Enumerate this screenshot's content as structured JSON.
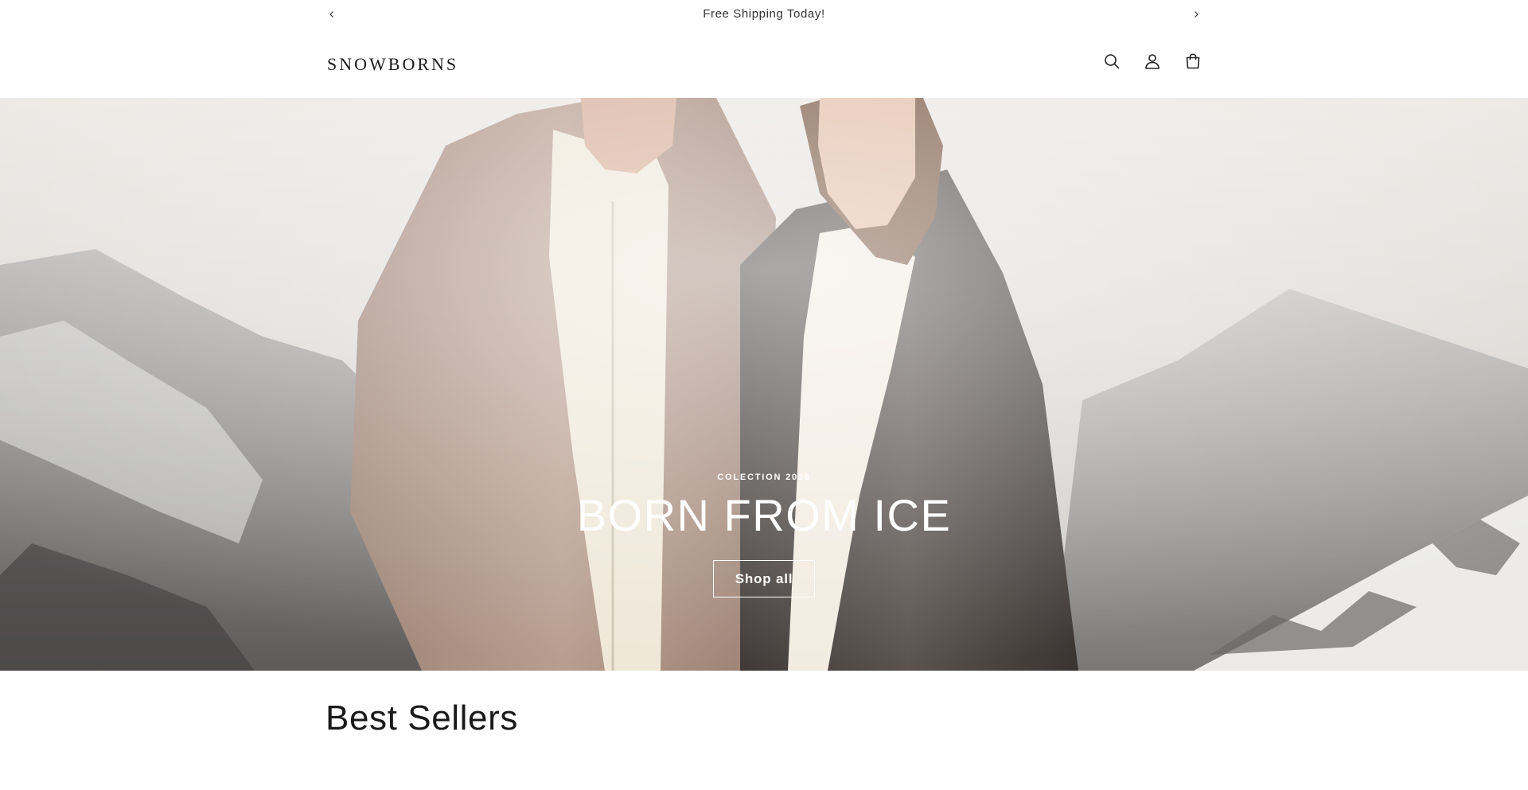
{
  "announcement": {
    "text": "Free Shipping Today!",
    "prev_icon": "chevron-left-icon",
    "next_icon": "chevron-right-icon"
  },
  "header": {
    "logo": "SNOWBORNS",
    "icons": [
      "search-icon",
      "account-icon",
      "cart-icon"
    ]
  },
  "hero": {
    "eyebrow": "COLECTION 2026",
    "title": "BORN FROM ICE",
    "button_label": "Shop all"
  },
  "best_sellers": {
    "title": "Best Sellers"
  },
  "colors": {
    "text": "#121212",
    "hero_text": "#ffffff",
    "background": "#ffffff"
  }
}
